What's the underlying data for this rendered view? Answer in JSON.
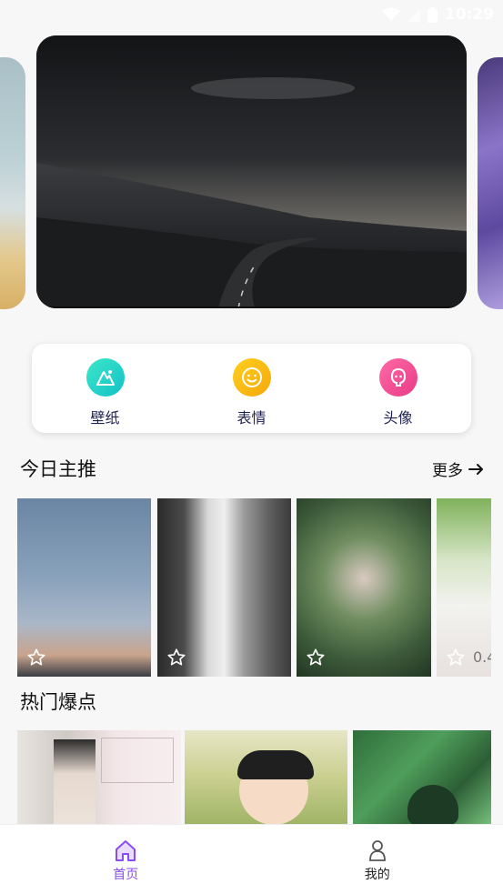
{
  "status_bar": {
    "time": "10:29"
  },
  "banner": {
    "cards": [
      "left",
      "main",
      "right"
    ]
  },
  "quick_actions": [
    {
      "label": "壁纸",
      "icon": "wallpaper-mountain-icon",
      "color": "#1cc9c6"
    },
    {
      "label": "表情",
      "icon": "smile-face-icon",
      "color": "#f5b20f"
    },
    {
      "label": "头像",
      "icon": "avatar-face-icon",
      "color": "#ee4c95"
    }
  ],
  "today": {
    "title": "今日主推",
    "more_label": "更多",
    "cards": [
      {
        "label": ""
      },
      {
        "label": ""
      },
      {
        "label": ""
      },
      {
        "label": "0.4"
      }
    ]
  },
  "hot": {
    "title": "热门爆点"
  },
  "bottom_nav": {
    "items": [
      {
        "label": "首页",
        "active": true,
        "color": "#8a4cf0"
      },
      {
        "label": "我的",
        "active": false,
        "color": "#222222"
      }
    ]
  }
}
